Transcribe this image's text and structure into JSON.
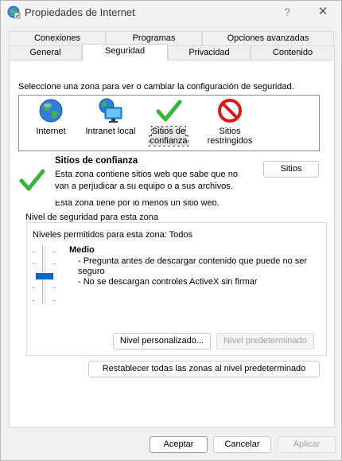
{
  "window": {
    "title": "Propiedades de Internet",
    "help_glyph": "?",
    "close_glyph": "✕"
  },
  "tabs": {
    "row1": [
      "Conexiones",
      "Programas",
      "Opciones avanzadas"
    ],
    "row2": [
      "General",
      "Seguridad",
      "Privacidad",
      "Contenido"
    ],
    "active": "Seguridad"
  },
  "security": {
    "instruction": "Seleccione una zona para ver o cambiar la configuración de seguridad.",
    "zones": [
      {
        "label_line1": "Internet",
        "label_line2": "",
        "icon": "globe-icon"
      },
      {
        "label_line1": "Intranet local",
        "label_line2": "",
        "icon": "network-monitor-icon"
      },
      {
        "label_line1": "Sitios de",
        "label_line2": "confianza",
        "icon": "checkmark-icon",
        "selected": true
      },
      {
        "label_line1": "Sitios",
        "label_line2": "restringidos",
        "icon": "prohibited-icon"
      }
    ],
    "zone_title": "Sitios de confianza",
    "zone_desc_line1": "Esta zona contiene sitios web que sabe que no",
    "zone_desc_line2": "van a perjudicar a su equipo o a sus archivos.",
    "zone_desc_line3": "Esta zona tiene por lo menos un sitio web.",
    "sites_button": "Sitios"
  },
  "level": {
    "group_title": "Nivel de seguridad para esta zona",
    "allowed": "Niveles permitidos para esta zona: Todos",
    "name": "Medio",
    "desc1": "- Pregunta antes de descargar contenido que puede no ser",
    "desc1b": "seguro",
    "desc2": "- No se descargan controles ActiveX sin firmar",
    "custom_button": "Nivel personalizado...",
    "default_button": "Nivel predeterminado",
    "reset_button": "Restablecer todas las zonas al nivel predeterminado"
  },
  "footer": {
    "ok": "Aceptar",
    "cancel": "Cancelar",
    "apply": "Aplicar"
  },
  "colors": {
    "accent": "#0067c0",
    "check_green": "#3bb33b",
    "prohibited_red": "#d41a1a"
  }
}
